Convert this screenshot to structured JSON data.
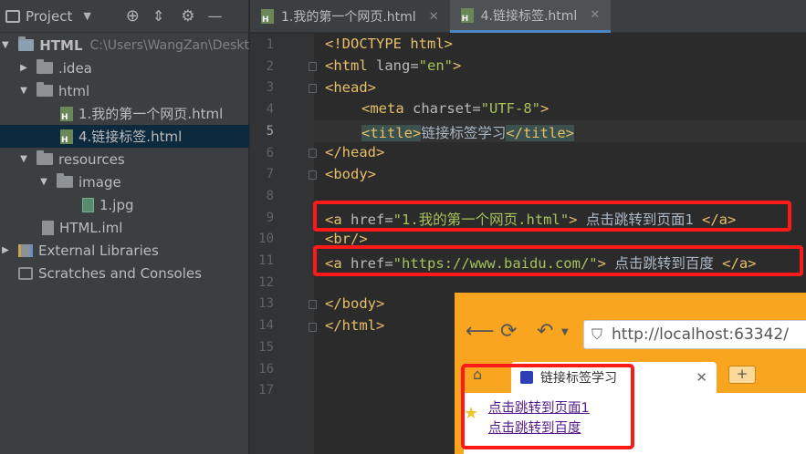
{
  "project_panel": {
    "title": "Project",
    "toolbar_icons": [
      "crosshair-icon",
      "collapse-icon",
      "gear-icon",
      "minimize-icon"
    ],
    "tree": [
      {
        "label": "HTML",
        "path": "C:\\Users\\WangZan\\Deskt",
        "type": "module",
        "expanded": true
      },
      {
        "label": ".idea",
        "type": "folder",
        "expanded": false
      },
      {
        "label": "html",
        "type": "folder",
        "expanded": true
      },
      {
        "label": "1.我的第一个网页.html",
        "type": "html-file"
      },
      {
        "label": "4.链接标签.html",
        "type": "html-file",
        "selected": true
      },
      {
        "label": "resources",
        "type": "folder",
        "expanded": true
      },
      {
        "label": "image",
        "type": "folder",
        "expanded": true
      },
      {
        "label": "1.jpg",
        "type": "image-file"
      },
      {
        "label": "HTML.iml",
        "type": "iml-file"
      },
      {
        "label": "External Libraries",
        "type": "libraries",
        "expanded": false
      },
      {
        "label": "Scratches and Consoles",
        "type": "scratches"
      }
    ]
  },
  "tabs": [
    {
      "label": "1.我的第一个网页.html",
      "active": false
    },
    {
      "label": "4.链接标签.html",
      "active": true
    }
  ],
  "editor": {
    "line_numbers": [
      "1",
      "2",
      "3",
      "4",
      "5",
      "6",
      "7",
      "8",
      "9",
      "10",
      "11",
      "12",
      "13",
      "14",
      "15",
      "16",
      "17"
    ],
    "current_line": 5,
    "lines": {
      "l1_tag": "<!DOCTYPE html>",
      "l2_open": "<html ",
      "l2_attr": "lang=",
      "l2_val": "\"en\"",
      "l2_close": ">",
      "l3": "<head>",
      "l4_open": "<meta ",
      "l4_attr": "charset=",
      "l4_val": "\"UTF-8\"",
      "l4_close": ">",
      "l5_open": "<title>",
      "l5_text": "链接标签学习",
      "l5_close": "</title>",
      "l6": "</head>",
      "l7": "<body>",
      "l9_open": "<a ",
      "l9_attr": "href=",
      "l9_val": "\"1.我的第一个网页.html\"",
      "l9_gt": ">",
      "l9_text": " 点击跳转到页面1 ",
      "l9_close": "</a>",
      "l10": "<br/>",
      "l11_open": "<a ",
      "l11_attr": "href=",
      "l11_val": "\"https://www.baidu.com/\"",
      "l11_gt": ">",
      "l11_text": " 点击跳转到百度 ",
      "l11_close": "</a>",
      "l13": "</body>",
      "l14": "</html>"
    }
  },
  "browser": {
    "address": "http://localhost:63342/",
    "tab_title": "链接标签学习",
    "new_tab_label": "+",
    "links": [
      "点击跳转到页面1",
      "点击跳转到百度"
    ]
  },
  "colors": {
    "tag": "#e8bf6a",
    "attribute_value": "#a5c25c",
    "highlight_box": "#ff1a1a",
    "browser_frame": "#f9a51f"
  }
}
